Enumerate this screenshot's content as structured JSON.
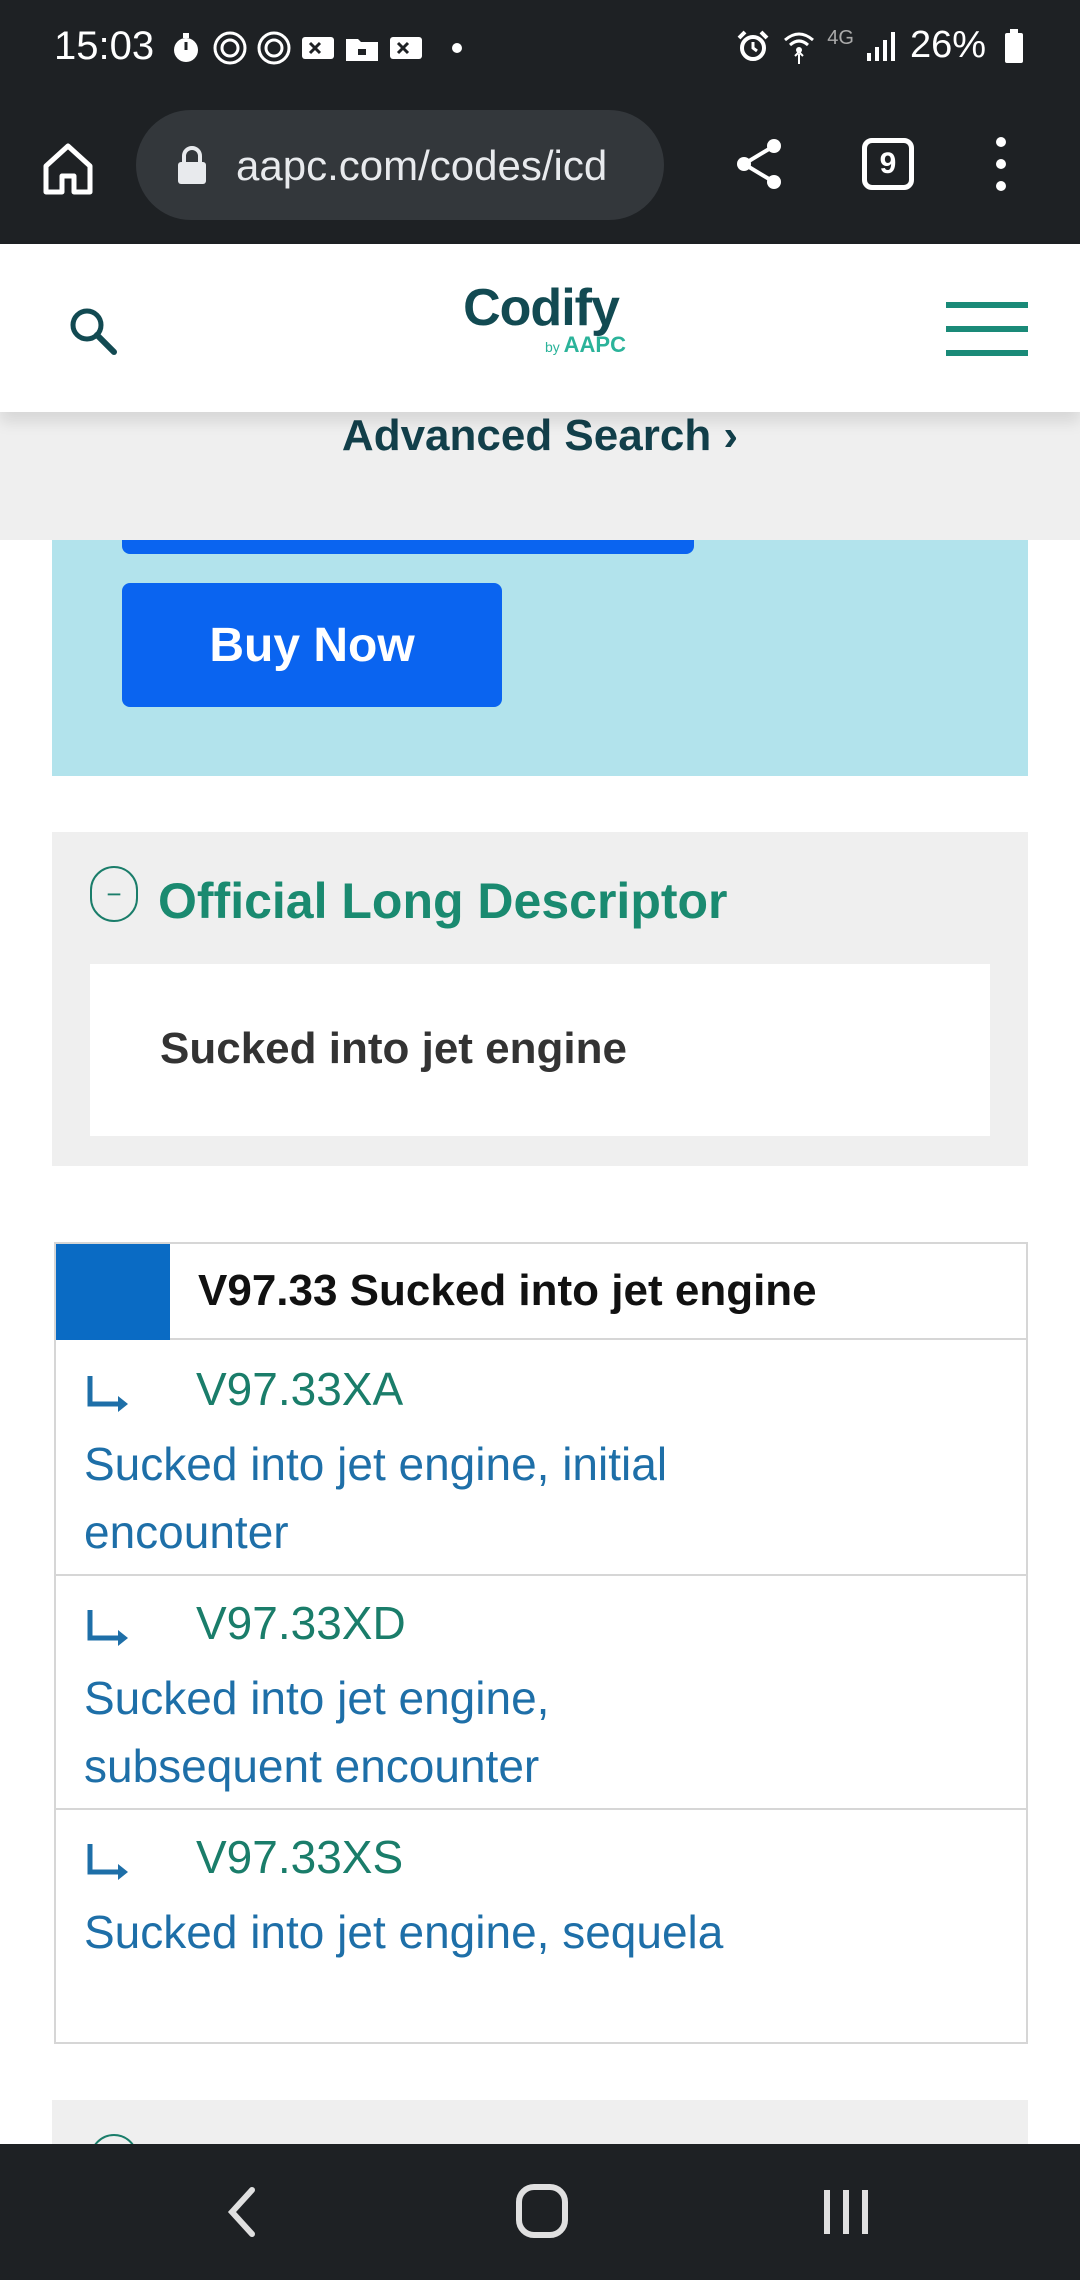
{
  "status_bar": {
    "time": "15:03",
    "network": "4G",
    "battery": "26%",
    "icons": [
      "timer-icon",
      "record-icon",
      "record-icon",
      "video-icon",
      "folder-icon",
      "video-icon",
      "alarm-icon",
      "wifi-icon",
      "signal-icon",
      "battery-icon"
    ]
  },
  "browser": {
    "url": "aapc.com/codes/icd",
    "tab_count": "9"
  },
  "header": {
    "logo_main": "Codify",
    "logo_by": "by",
    "logo_brand": "AAPC"
  },
  "advanced_search": {
    "label": "Advanced Search ›"
  },
  "promo": {
    "buy_label": "Buy Now"
  },
  "descriptor": {
    "title": "Official Long Descriptor",
    "collapse_symbol": "−",
    "text": "Sucked into jet engine"
  },
  "code_table": {
    "title": "V97.33 Sucked into jet engine",
    "rows": [
      {
        "code": "V97.33XA",
        "description": "Sucked into jet engine, initial encounter"
      },
      {
        "code": "V97.33XD",
        "description": "Sucked into jet engine, subsequent encounter"
      },
      {
        "code": "V97.33XS",
        "description": "Sucked into jet engine, sequela"
      }
    ]
  },
  "colors": {
    "brand_teal": "#1a8a70",
    "link_blue": "#1e6fa8",
    "button_blue": "#0a64f0",
    "promo_bg": "#b2e3ec"
  }
}
